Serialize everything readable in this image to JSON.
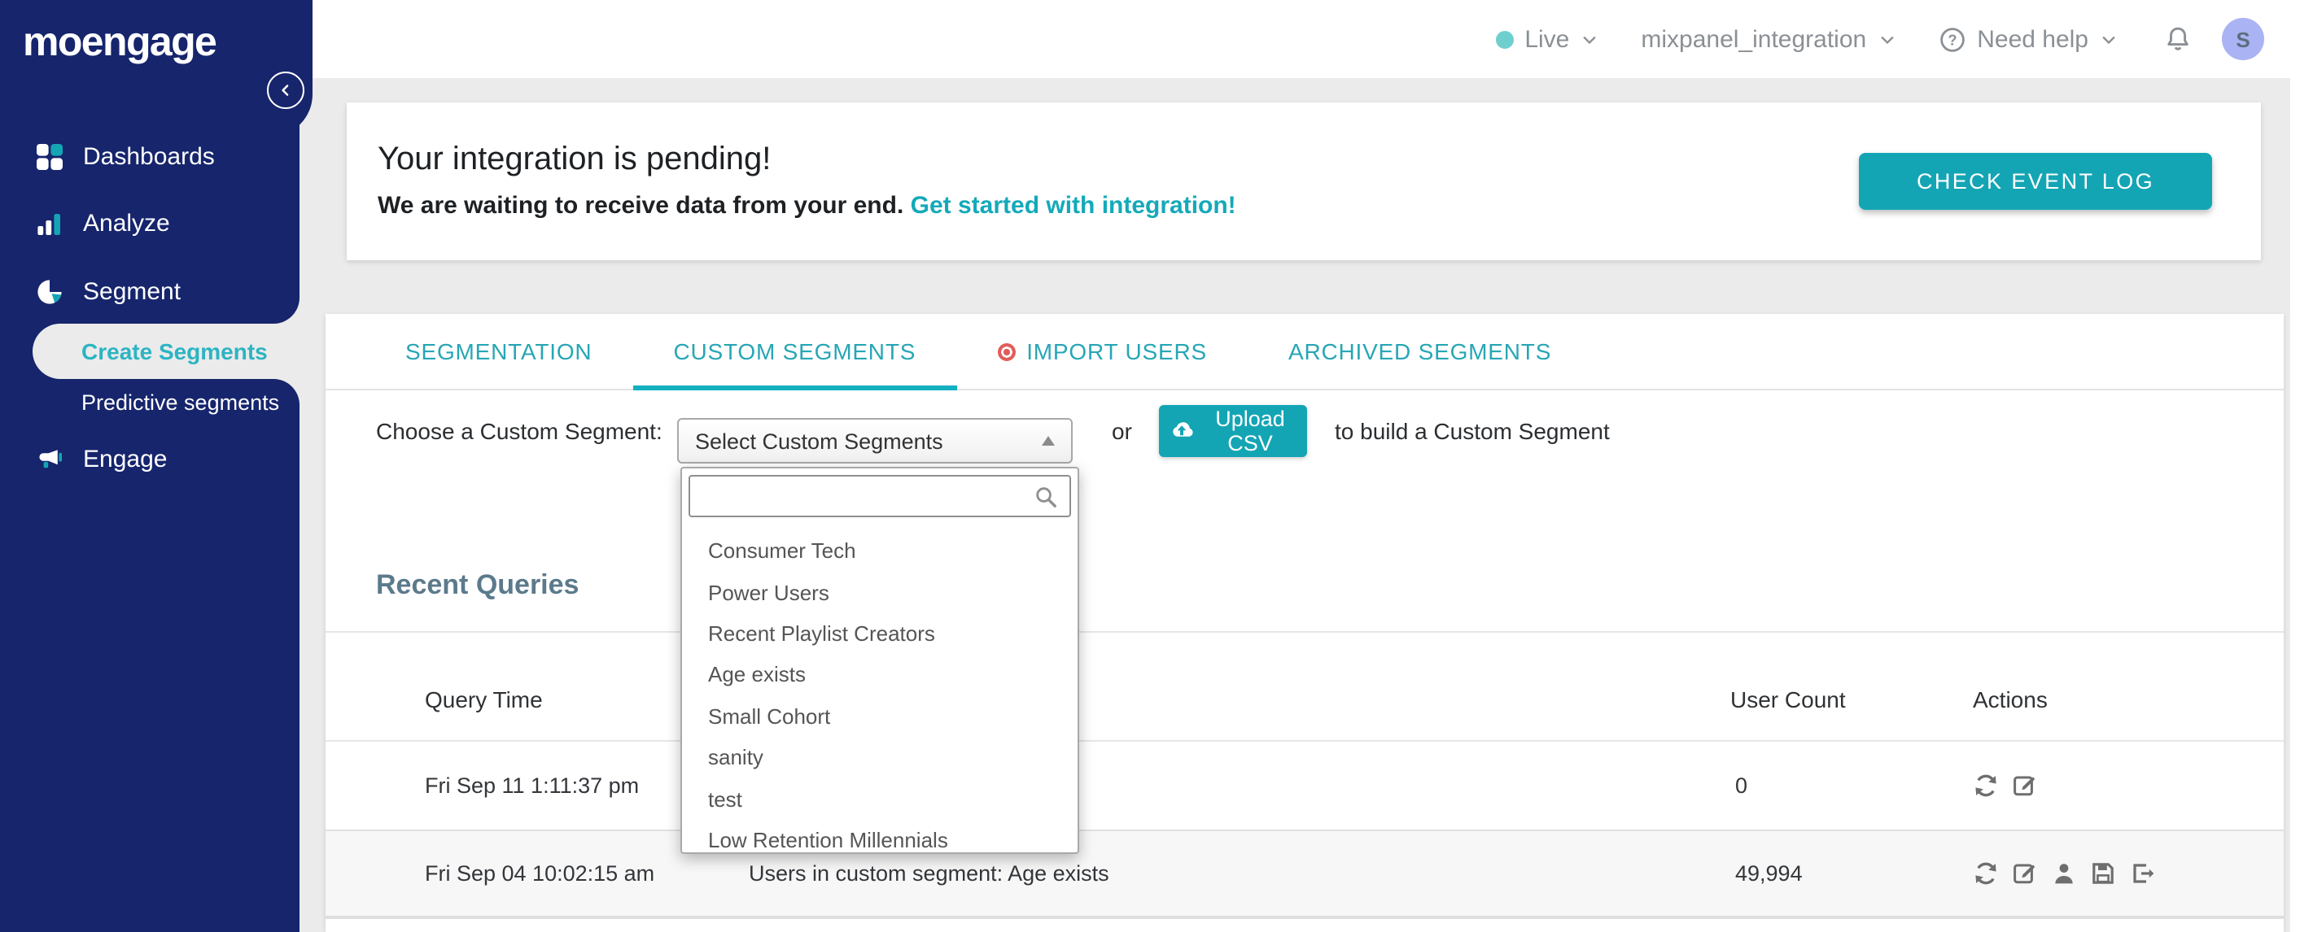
{
  "colors": {
    "navy": "#16256c",
    "accent": "#14a5b5",
    "tab_teal": "#27a6b5",
    "link_teal": "#14a9b9",
    "badge_red": "#e25c5c",
    "avatar_bg": "#aab3f3",
    "live_dot": "#6fcfcf"
  },
  "brand": {
    "logo": "moengage"
  },
  "sidebar": {
    "items": [
      {
        "label": "Dashboards",
        "icon": "dashboards-icon"
      },
      {
        "label": "Analyze",
        "icon": "analyze-icon"
      },
      {
        "label": "Segment",
        "icon": "segment-icon"
      },
      {
        "label": "Create Segments",
        "active": true
      },
      {
        "label": "Predictive segments"
      },
      {
        "label": "Engage",
        "icon": "engage-icon"
      }
    ]
  },
  "topbar": {
    "environment": "Live",
    "project": "mixpanel_integration",
    "help": "Need help",
    "avatar_initial": "S"
  },
  "banner": {
    "title": "Your integration is pending!",
    "subtitle": "We are waiting to receive data from your end.",
    "link": "Get started with integration!",
    "button": "CHECK EVENT LOG"
  },
  "tabs": {
    "items": [
      {
        "label": "SEGMENTATION"
      },
      {
        "label": "CUSTOM SEGMENTS",
        "active": true
      },
      {
        "label": "IMPORT USERS",
        "badge": "red-dot"
      },
      {
        "label": "ARCHIVED SEGMENTS"
      }
    ]
  },
  "chooser": {
    "label": "Choose a Custom Segment:",
    "select_value": "Select Custom Segments",
    "or": "or",
    "upload_button": "Upload CSV",
    "suffix": "to build a Custom Segment"
  },
  "dropdown": {
    "search_value": "",
    "options": [
      "Consumer Tech",
      "Power Users",
      "Recent Playlist Creators",
      "Age exists",
      "Small Cohort",
      "sanity",
      "test",
      "Low Retention Millennials"
    ]
  },
  "recent_queries": {
    "title": "Recent Queries",
    "columns": {
      "time": "Query Time",
      "user_count": "User Count",
      "actions": "Actions"
    },
    "rows": [
      {
        "time": "Fri Sep 11 1:11:37 pm",
        "query": "",
        "user_count": "0",
        "actions": [
          "refresh",
          "edit"
        ]
      },
      {
        "time": "Fri Sep 04 10:02:15 am",
        "query": "Users in custom segment: Age exists",
        "user_count": "49,994",
        "actions": [
          "refresh",
          "edit",
          "user",
          "save",
          "export"
        ]
      }
    ]
  }
}
